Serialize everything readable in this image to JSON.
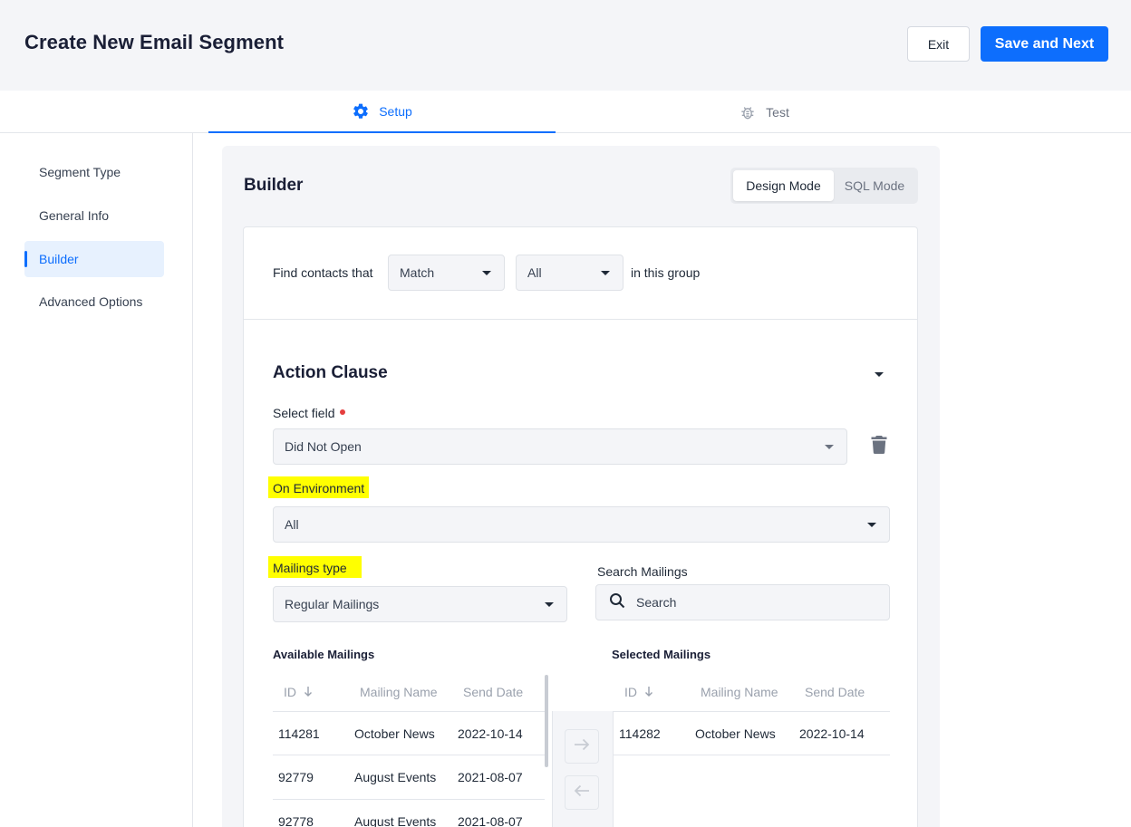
{
  "header": {
    "title": "Create New Email Segment",
    "exit_label": "Exit",
    "save_label": "Save and Next"
  },
  "tabs": [
    {
      "label": "Setup",
      "icon": "gear-icon",
      "active": true
    },
    {
      "label": "Test",
      "icon": "bug-icon",
      "active": false
    }
  ],
  "sidebar": {
    "items": [
      {
        "label": "Segment Type"
      },
      {
        "label": "General Info"
      },
      {
        "label": "Builder",
        "active": true
      },
      {
        "label": "Advanced Options"
      }
    ]
  },
  "builder": {
    "title": "Builder",
    "modes": {
      "design": "Design Mode",
      "sql": "SQL Mode",
      "active": "design"
    },
    "find_prefix": "Find contacts that",
    "match_value": "Match",
    "scope_value": "All",
    "find_suffix": "in this group",
    "clause": {
      "title": "Action Clause",
      "select_field_label": "Select field",
      "select_field_value": "Did Not Open",
      "environment_label": "On Environment",
      "environment_value": "All",
      "mailings_type_label": "Mailings type",
      "mailings_type_value": "Regular Mailings",
      "search_label": "Search Mailings",
      "search_placeholder": "Search"
    },
    "available": {
      "title": "Available Mailings",
      "columns": {
        "id": "ID",
        "name": "Mailing Name",
        "date": "Send Date"
      },
      "rows": [
        {
          "id": "114281",
          "name": "October News",
          "date": "2022-10-14"
        },
        {
          "id": "92779",
          "name": "August Events",
          "date": "2021-08-07"
        },
        {
          "id": "92778",
          "name": "August Events",
          "date": "2021-08-07"
        }
      ]
    },
    "selected": {
      "title": "Selected Mailings",
      "columns": {
        "id": "ID",
        "name": "Mailing Name",
        "date": "Send Date"
      },
      "rows": [
        {
          "id": "114282",
          "name": "October News",
          "date": "2022-10-14"
        }
      ]
    }
  },
  "colors": {
    "primary": "#0d6efd",
    "highlight": "#ffff00",
    "required": "#e53e3e"
  }
}
